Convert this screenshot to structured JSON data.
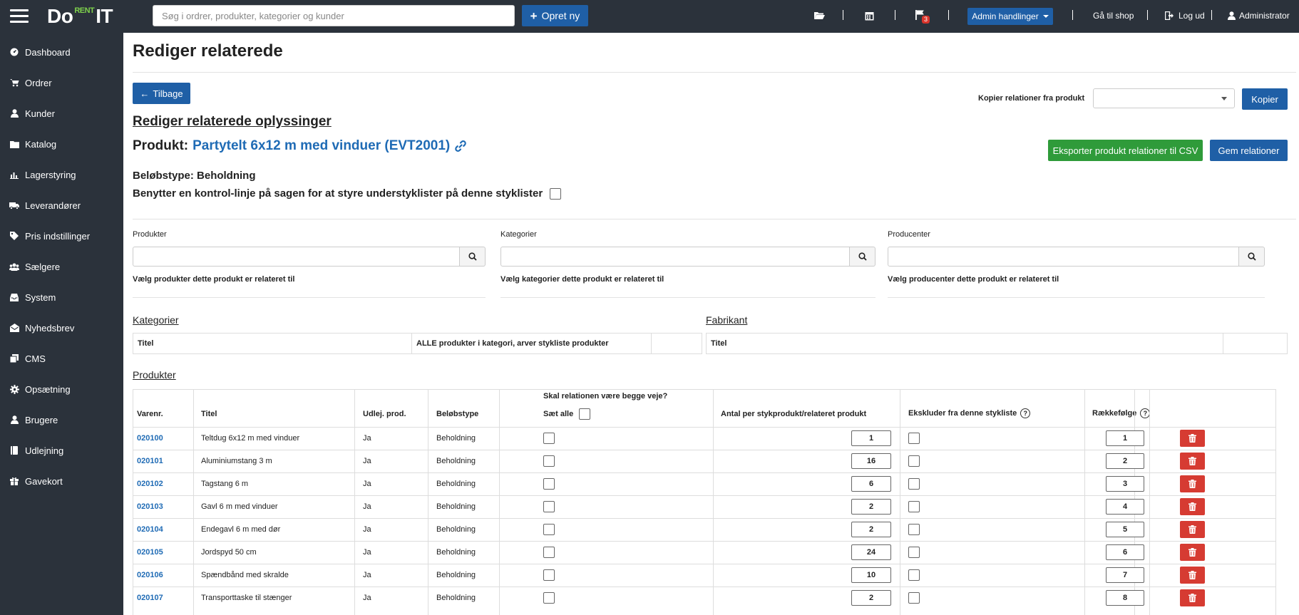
{
  "topbar": {
    "logo_do": "Do",
    "logo_rent": "RENT",
    "logo_it": "IT",
    "search_placeholder": "Søg i ordrer, produkter, kategorier og kunder",
    "create_label": "Opret ny",
    "notifications_count": "3",
    "admin_label": "Admin handlinger",
    "shop_label": "Gå til shop",
    "logout_label": "Log ud",
    "user_label": "Administrator"
  },
  "sidebar": {
    "items": [
      {
        "label": "Dashboard",
        "icon": "dashboard-icon"
      },
      {
        "label": "Ordrer",
        "icon": "cart-icon"
      },
      {
        "label": "Kunder",
        "icon": "user-icon"
      },
      {
        "label": "Katalog",
        "icon": "folder-icon"
      },
      {
        "label": "Lagerstyring",
        "icon": "bar-chart-icon"
      },
      {
        "label": "Leverandører",
        "icon": "truck-icon"
      },
      {
        "label": "Pris indstillinger",
        "icon": "tag-icon"
      },
      {
        "label": "Sælgere",
        "icon": "users-icon"
      },
      {
        "label": "System",
        "icon": "inbox-icon"
      },
      {
        "label": "Nyhedsbrev",
        "icon": "envelope-icon"
      },
      {
        "label": "CMS",
        "icon": "copy-icon"
      },
      {
        "label": "Opsætning",
        "icon": "gear-icon"
      },
      {
        "label": "Brugere",
        "icon": "user-icon"
      },
      {
        "label": "Udlejning",
        "icon": "book-icon"
      },
      {
        "label": "Gavekort",
        "icon": "gift-icon"
      }
    ]
  },
  "page": {
    "title": "Rediger relaterede",
    "back_label": "Tilbage",
    "copy_label": "Kopier relationer fra produkt",
    "copy_button": "Kopier",
    "subtitle": "Rediger relaterede oplyssinger",
    "product_prefix": "Produkt:",
    "product_name": "Partytelt 6x12 m med vinduer (EVT2001)",
    "export_button": "Eksporter produkt relationer til CSV",
    "save_button": "Gem relationer",
    "amount_type": "Beløbstype: Beholdning",
    "control_line": "Benytter en kontrol-linje på sagen for at styre understyklister på denne styklister"
  },
  "filters": {
    "products_label": "Produkter",
    "products_help": "Vælg produkter dette produkt er relateret til",
    "categories_label": "Kategorier",
    "categories_help": "Vælg kategorier dette produkt er relateret til",
    "producers_label": "Producenter",
    "producers_help": "Vælg producenter dette produkt er relateret til"
  },
  "categories_section": {
    "title": "Kategorier",
    "col_title": "Titel",
    "col_all": "ALLE produkter i kategori, arver stykliste produkter"
  },
  "manufacturer_section": {
    "title": "Fabrikant",
    "col_title": "Titel"
  },
  "products_section": {
    "title": "Produkter",
    "headers": {
      "sku": "Varenr.",
      "title": "Titel",
      "rental": "Udlej. prod.",
      "amount_type": "Beløbstype",
      "both_ways": "Skal relationen være begge veje?",
      "set_all": "Sæt alle",
      "qty": "Antal per stykprodukt/relateret produkt",
      "exclude": "Ekskluder fra denne stykliste",
      "order": "Rækkefølge"
    },
    "rows": [
      {
        "sku": "020100",
        "title": "Teltdug 6x12 m med vinduer",
        "rental": "Ja",
        "type": "Beholdning",
        "qty": "1",
        "order": "1"
      },
      {
        "sku": "020101",
        "title": "Aluminiumstang 3 m",
        "rental": "Ja",
        "type": "Beholdning",
        "qty": "16",
        "order": "2"
      },
      {
        "sku": "020102",
        "title": "Tagstang 6 m",
        "rental": "Ja",
        "type": "Beholdning",
        "qty": "6",
        "order": "3"
      },
      {
        "sku": "020103",
        "title": "Gavl 6 m med vinduer",
        "rental": "Ja",
        "type": "Beholdning",
        "qty": "2",
        "order": "4"
      },
      {
        "sku": "020104",
        "title": "Endegavl 6 m med dør",
        "rental": "Ja",
        "type": "Beholdning",
        "qty": "2",
        "order": "5"
      },
      {
        "sku": "020105",
        "title": "Jordspyd 50 cm",
        "rental": "Ja",
        "type": "Beholdning",
        "qty": "24",
        "order": "6"
      },
      {
        "sku": "020106",
        "title": "Spændbånd med skralde",
        "rental": "Ja",
        "type": "Beholdning",
        "qty": "10",
        "order": "7"
      },
      {
        "sku": "020107",
        "title": "Transporttaske til stænger",
        "rental": "Ja",
        "type": "Beholdning",
        "qty": "2",
        "order": "8"
      }
    ]
  }
}
